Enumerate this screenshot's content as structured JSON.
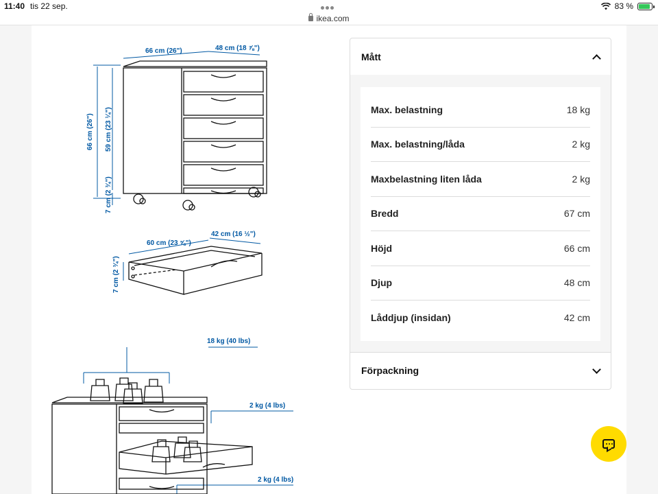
{
  "status": {
    "time": "11:40",
    "date": "tis 22 sep.",
    "battery": "83 %"
  },
  "browser": {
    "url": "ikea.com"
  },
  "illustration": {
    "width_label": "66 cm (26\")",
    "depth_label": "48 cm (18 ⅞\")",
    "height_label": "66 cm (26\")",
    "body_height_label": "59 cm (23 ¼\")",
    "wheel_height_label": "7 cm (2 ¾\")",
    "drawer_width_label": "60 cm (23 ⅝\")",
    "drawer_depth_label": "42 cm (16 ½\")",
    "drawer_height_label": "7 cm (2 ¾\")",
    "load_total_label": "18 kg (40 lbs)",
    "load_drawer_label_1": "2 kg (4 lbs)",
    "load_drawer_label_2": "2 kg (4 lbs)"
  },
  "accordion": {
    "section1_title": "Mått",
    "specs": [
      {
        "label": "Max. belastning",
        "value": "18 kg"
      },
      {
        "label": "Max. belastning/låda",
        "value": "2 kg"
      },
      {
        "label": "Maxbelastning liten låda",
        "value": "2 kg"
      },
      {
        "label": "Bredd",
        "value": "67 cm"
      },
      {
        "label": "Höjd",
        "value": "66 cm"
      },
      {
        "label": "Djup",
        "value": "48 cm"
      },
      {
        "label": "Låddjup (insidan)",
        "value": "42 cm"
      }
    ],
    "section2_title": "Förpackning"
  },
  "colors": {
    "accent_blue": "#0058a3",
    "chat_yellow": "#ffdb00"
  }
}
